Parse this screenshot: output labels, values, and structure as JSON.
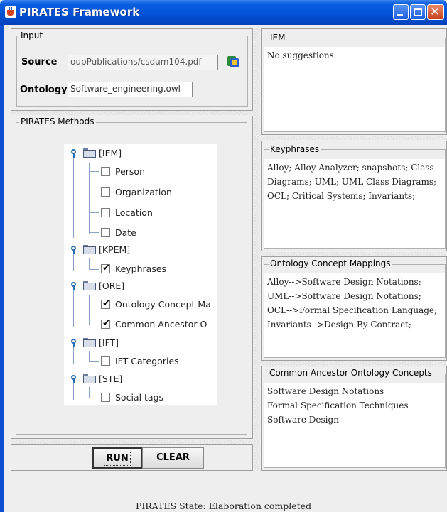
{
  "window": {
    "title": "PIRATES Framework"
  },
  "input_group": {
    "title": "Input",
    "source_label": "Source",
    "source_value": "oupPublications/csdum104.pdf",
    "ontology_label": "Ontology",
    "ontology_value": "Software_engineering.owl"
  },
  "methods_group": {
    "title": "PIRATES Methods",
    "tree": [
      {
        "label": "[IEM]",
        "children": [
          {
            "label": "Person",
            "checked": false
          },
          {
            "label": "Organization",
            "checked": false
          },
          {
            "label": "Location",
            "checked": false
          },
          {
            "label": "Date",
            "checked": false
          }
        ]
      },
      {
        "label": "[KPEM]",
        "children": [
          {
            "label": "Keyphrases",
            "checked": true
          }
        ]
      },
      {
        "label": "[ORE]",
        "children": [
          {
            "label": "Ontology Concept Ma",
            "checked": true
          },
          {
            "label": "Common Ancestor O",
            "checked": true
          }
        ]
      },
      {
        "label": "[IFT]",
        "children": [
          {
            "label": "IFT Categories",
            "checked": false
          }
        ]
      },
      {
        "label": "[STE]",
        "children": [
          {
            "label": "Social tags",
            "checked": false
          }
        ]
      }
    ],
    "check_mark": "✔"
  },
  "buttons": {
    "run": "RUN",
    "clear": "CLEAR"
  },
  "iem_panel": {
    "title": "IEM",
    "text": "No suggestions"
  },
  "keyphrases_panel": {
    "title": "Keyphrases",
    "lines": [
      "Alloy; Alloy Analyzer; snapshots; Class",
      "Diagrams; UML; UML Class Diagrams;",
      "OCL; Critical Systems; Invariants;"
    ]
  },
  "ontology_mappings_panel": {
    "title": "Ontology Concept Mappings",
    "lines": [
      "Alloy-->Software Design Notations;",
      "UML-->Software Design Notations;",
      "OCL-->Formal Specification Language;",
      "Invariants-->Design By Contract;"
    ]
  },
  "common_ancestor_panel": {
    "title": "Common Ancestor Ontology Concepts",
    "lines": [
      "Software Design Notations",
      "Formal Specification Techniques",
      "Software Design"
    ]
  },
  "status": {
    "text": "PIRATES State: Elaboration completed"
  },
  "colors": {
    "titlebar": "#0355d8",
    "window_bg": "#eeeeee",
    "close_button": "#c8401e"
  }
}
